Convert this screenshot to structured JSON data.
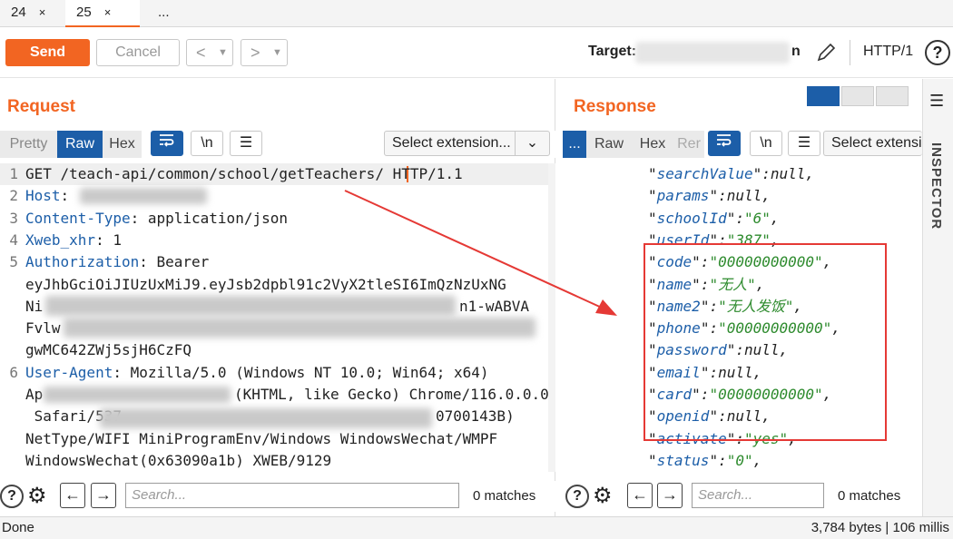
{
  "tabs": [
    {
      "label": "24",
      "close": "×"
    },
    {
      "label": "25",
      "close": "×"
    },
    {
      "label": "..."
    }
  ],
  "toolbar": {
    "send_label": "Send",
    "cancel_label": "Cancel",
    "target_label": "Target:",
    "target_tail": "n",
    "protocol_label": "HTTP/1",
    "help_label": "?"
  },
  "request": {
    "title": "Request",
    "modes": [
      "Pretty",
      "Raw",
      "Hex"
    ],
    "selected_mode": "Raw",
    "newline_label": "\\n",
    "select_ext_label": "Select extension...",
    "lines": [
      {
        "num": "1",
        "text": "GET /teach-api/common/school/getTeachers/",
        "suffix": " HTTP/1.1"
      },
      {
        "num": "2",
        "key": "Host",
        "rest": ": "
      },
      {
        "num": "3",
        "key": "Content-Type",
        "rest": ": application/json"
      },
      {
        "num": "4",
        "key": "Xweb_xhr",
        "rest": ": 1"
      },
      {
        "num": "5",
        "key": "Authorization",
        "rest": ": Bearer"
      },
      {
        "num": "",
        "text": "eyJhbGciOiJIUzUxMiJ9.eyJsb2dpbl91c2VyX2tleSI6ImQzNzUxNG"
      },
      {
        "num": "",
        "text": "Ni",
        "tail": "n1-wABVA"
      },
      {
        "num": "",
        "text": "Fvlw"
      },
      {
        "num": "",
        "text": "gwMC642ZWj5sjH6CzFQ"
      },
      {
        "num": "6",
        "key": "User-Agent",
        "rest": ": Mozilla/5.0 (Windows NT 10.0; Win64; x64)"
      },
      {
        "num": "",
        "text": "Ap",
        "tail": "(KHTML, like Gecko) Chrome/116.0.0.0"
      },
      {
        "num": "",
        "text": " Safari/537",
        "tail": "0700143B)"
      },
      {
        "num": "",
        "text": "NetType/WIFI MiniProgramEnv/Windows WindowsWechat/WMPF"
      },
      {
        "num": "",
        "text": "WindowsWechat(0x63090a1b) XWEB/9129"
      }
    ],
    "search_placeholder": "Search...",
    "matches": "0 matches"
  },
  "response": {
    "title": "Response",
    "modes": [
      "...",
      "Raw",
      "Hex",
      "Rer"
    ],
    "newline_label": "\\n",
    "select_ext_label": "Select extensi",
    "lines": [
      {
        "k": "searchValue",
        "v": "null",
        "t": "null"
      },
      {
        "k": "params",
        "v": "null",
        "t": "null"
      },
      {
        "k": "schoolId",
        "v": "\"6\"",
        "t": "str"
      },
      {
        "k": "userId",
        "v": "\"387\"",
        "t": "str"
      },
      {
        "k": "code",
        "v": "\"00000000000\"",
        "t": "str"
      },
      {
        "k": "name",
        "v": "\"无人\"",
        "t": "str"
      },
      {
        "k": "name2",
        "v": "\"无人发饭\"",
        "t": "str"
      },
      {
        "k": "phone",
        "v": "\"00000000000\"",
        "t": "str"
      },
      {
        "k": "password",
        "v": "null",
        "t": "null"
      },
      {
        "k": "email",
        "v": "null",
        "t": "null"
      },
      {
        "k": "card",
        "v": "\"00000000000\"",
        "t": "str"
      },
      {
        "k": "openid",
        "v": "null",
        "t": "null"
      },
      {
        "k": "activate",
        "v": "\"yes\"",
        "t": "str"
      },
      {
        "k": "status",
        "v": "\"0\"",
        "t": "str"
      }
    ],
    "search_placeholder": "Search...",
    "matches": "0 matches"
  },
  "inspector_label": "INSPECTOR",
  "status": {
    "left": "Done",
    "right": "3,784 bytes | 106 millis"
  },
  "colors": {
    "accent": "#f26522",
    "selected": "#1c5ea8",
    "highlight": "#e53935"
  }
}
